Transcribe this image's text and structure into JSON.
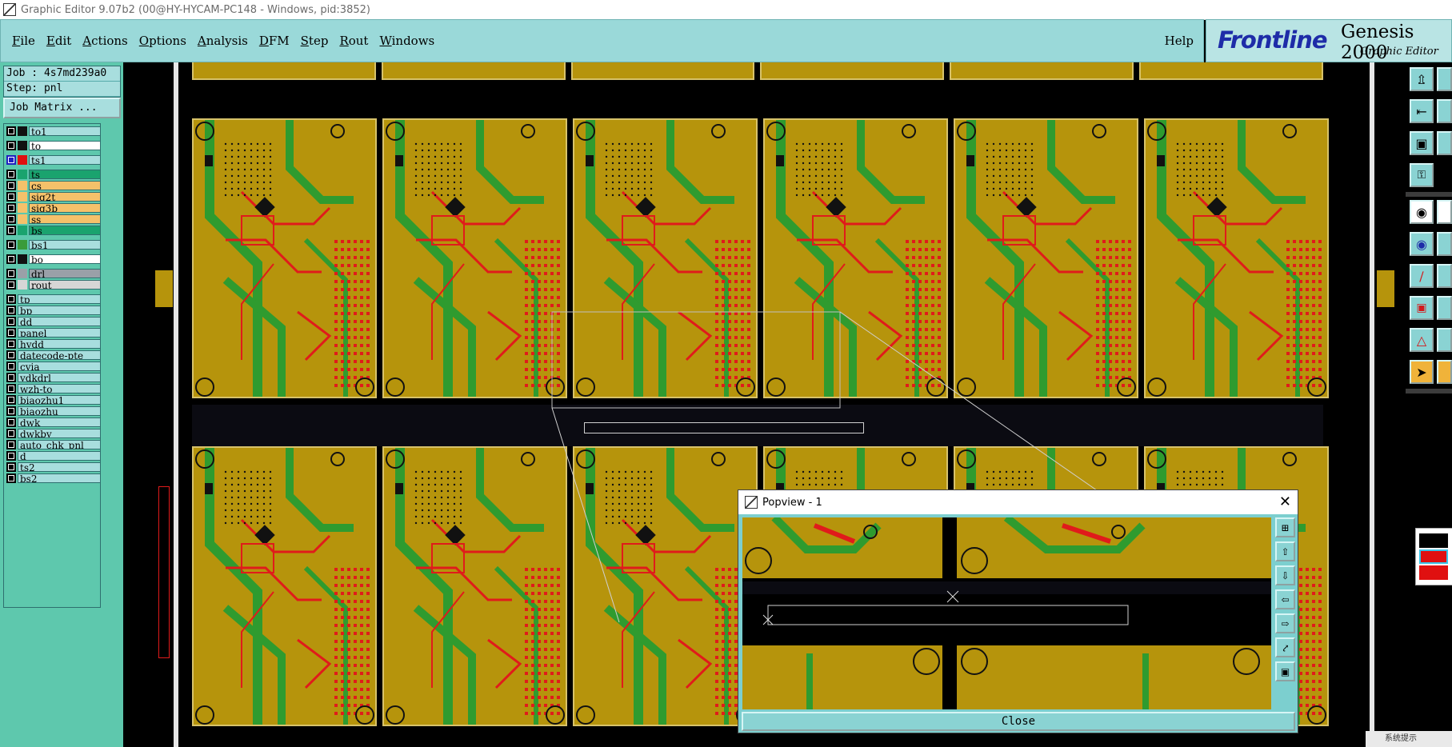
{
  "window": {
    "title": "Graphic Editor 9.07b2 (00@HY-HYCAM-PC148 - Windows, pid:3852)"
  },
  "menu": {
    "items": [
      "File",
      "Edit",
      "Actions",
      "Options",
      "Analysis",
      "DFM",
      "Step",
      "Rout",
      "Windows"
    ],
    "help": "Help"
  },
  "logo": {
    "brand": "Frontline",
    "product": "Genesis 2000",
    "subtitle": "Graphic Editor"
  },
  "job": {
    "job_label": "Job : 4s7md239a0",
    "step_label": "Step: pnl",
    "matrix_button": "Job Matrix ..."
  },
  "layers": [
    {
      "name": "to1",
      "swatch": "#111111",
      "bg": "#a8dede"
    },
    {
      "name": "to",
      "swatch": "#111111",
      "bg": "#ffffff"
    },
    {
      "name": "ts1",
      "swatch": "#e01010",
      "bg": "#a8dede",
      "checkColor": "#2020c0"
    },
    {
      "name": "ts",
      "swatch": "#1aa36e",
      "bg": "#1aa36e"
    },
    {
      "name": "cs",
      "swatch": "#f5c16a",
      "bg": "#f5c16a"
    },
    {
      "name": "sig2t",
      "swatch": "#f5c16a",
      "bg": "#f5c16a"
    },
    {
      "name": "sig3b",
      "swatch": "#f5c16a",
      "bg": "#f5c16a"
    },
    {
      "name": "ss",
      "swatch": "#f5c16a",
      "bg": "#f5c16a"
    },
    {
      "name": "bs",
      "swatch": "#1aa36e",
      "bg": "#1aa36e"
    },
    {
      "name": "bs1",
      "swatch": "#3a9b3a",
      "bg": "#a8dede"
    },
    {
      "name": "bo",
      "swatch": "#111111",
      "bg": "#ffffff"
    },
    {
      "name": "drl",
      "swatch": "#9aa0a8",
      "bg": "#9aa0a8"
    },
    {
      "name": "rout",
      "swatch": "#d6d6d6",
      "bg": "#d6d6d6"
    },
    {
      "name": "tp",
      "bg": "#a8dede"
    },
    {
      "name": "bp",
      "bg": "#a8dede"
    },
    {
      "name": "dd",
      "bg": "#a8dede"
    },
    {
      "name": "panel",
      "bg": "#a8dede"
    },
    {
      "name": "hydd",
      "bg": "#a8dede"
    },
    {
      "name": "datecode-pte",
      "bg": "#a8dede"
    },
    {
      "name": "cvia",
      "bg": "#a8dede"
    },
    {
      "name": "ydkdrl",
      "bg": "#a8dede"
    },
    {
      "name": "wzh-to",
      "bg": "#a8dede"
    },
    {
      "name": "biaozhu1",
      "bg": "#a8dede"
    },
    {
      "name": "biaozhu",
      "bg": "#a8dede"
    },
    {
      "name": "dwk",
      "bg": "#a8dede"
    },
    {
      "name": "dwkby",
      "bg": "#a8dede"
    },
    {
      "name": "auto_chk_pnl",
      "bg": "#a8dede"
    },
    {
      "name": "d",
      "bg": "#a8dede"
    },
    {
      "name": "ts2",
      "bg": "#a8dede"
    },
    {
      "name": "bs2",
      "bg": "#a8dede"
    }
  ],
  "popview": {
    "title": "Popview - 1",
    "close_label": "Close",
    "close_glyph": "✕"
  },
  "taskbar": {
    "notification": "系统提示"
  },
  "colors": {
    "board": "#b6940c",
    "copper_green": "#2f9b2f",
    "trace_red": "#e01b1b",
    "panel_bg": "#5ec8ad",
    "menu_bg": "#9ad9d9"
  },
  "icons": [
    "app-icon",
    "zoom-home-icon",
    "zoom-in-icon",
    "zoom-out-icon",
    "zoom-fit-icon",
    "measure-icon",
    "select-icon",
    "snap-icon",
    "arrow-icon"
  ]
}
